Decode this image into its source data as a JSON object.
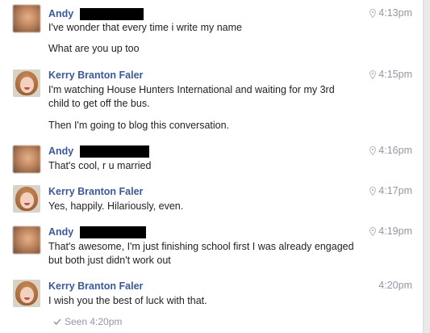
{
  "messages": [
    {
      "sender": "Andy",
      "sender_redacted": true,
      "avatar": "andy-blurred-avatar",
      "time": "4:13pm",
      "show_pin": true,
      "lines": [
        "I've wonder that every time i write my name"
      ],
      "extra": [
        "What are you up too"
      ]
    },
    {
      "sender": "Kerry Branton Faler",
      "sender_redacted": false,
      "avatar": "kerry-avatar",
      "time": "4:15pm",
      "show_pin": true,
      "lines": [
        "I'm watching House Hunters International and waiting for my 3rd",
        "child to get off the bus."
      ],
      "extra": [
        "Then I'm going to blog this conversation."
      ]
    },
    {
      "sender": "Andy",
      "sender_redacted": true,
      "avatar": "andy-blurred-avatar",
      "time": "4:16pm",
      "show_pin": true,
      "lines": [
        "That's cool, r u married"
      ],
      "extra": []
    },
    {
      "sender": "Kerry Branton Faler",
      "sender_redacted": false,
      "avatar": "kerry-avatar",
      "time": "4:17pm",
      "show_pin": true,
      "lines": [
        "Yes, happily. Hilariously, even."
      ],
      "extra": []
    },
    {
      "sender": "Andy",
      "sender_redacted": true,
      "avatar": "andy-blurred-avatar",
      "time": "4:19pm",
      "show_pin": true,
      "lines": [
        "That's awesome, I'm just finishing school first I was already engaged",
        "but both just didn't work out"
      ],
      "extra": []
    },
    {
      "sender": "Kerry Branton Faler",
      "sender_redacted": false,
      "avatar": "kerry-avatar",
      "time": "4:20pm",
      "show_pin": false,
      "lines": [
        "I wish you the best of luck with that."
      ],
      "extra": []
    }
  ],
  "seen_status": "Seen 4:20pm",
  "colors": {
    "sender_name": "#3b5998",
    "timestamp": "#9197a3",
    "message_text": "#222222",
    "redaction": "#000000"
  },
  "icons": {
    "timestamp": "location-pin-icon",
    "seen": "checkmark-icon"
  }
}
